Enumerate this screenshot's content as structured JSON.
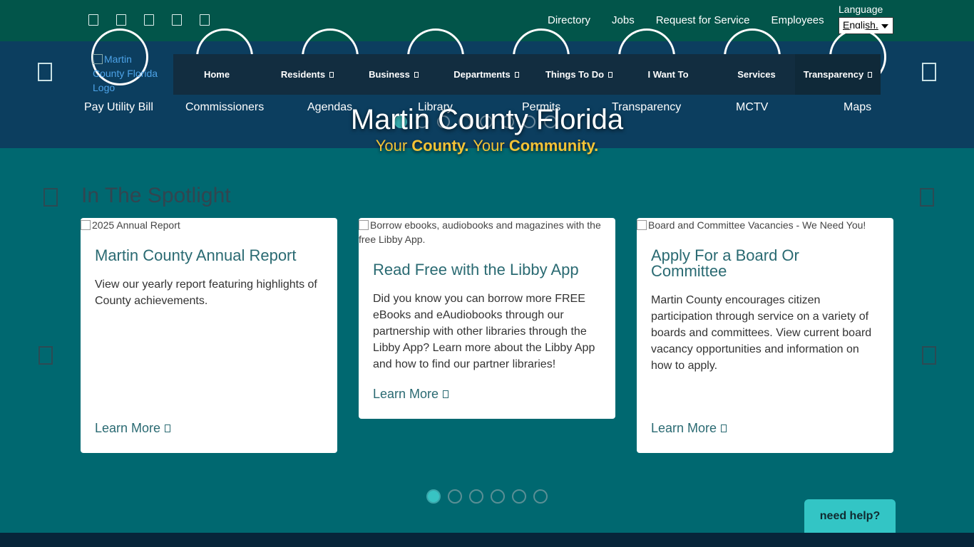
{
  "topbar": {
    "social_icons": [
      "social-icon-1",
      "social-icon-2",
      "social-icon-3",
      "social-icon-4",
      "social-icon-5"
    ],
    "links": [
      "Directory",
      "Jobs",
      "Request for Service",
      "Employees"
    ],
    "language_label": "Language",
    "language_value": "English."
  },
  "header": {
    "logo_alt": "Martin County Florida Logo",
    "nav": [
      {
        "label": "Home",
        "dropdown": false
      },
      {
        "label": "Residents",
        "dropdown": true
      },
      {
        "label": "Business",
        "dropdown": true
      },
      {
        "label": "Departments",
        "dropdown": true
      },
      {
        "label": "Things To Do",
        "dropdown": true
      },
      {
        "label": "I Want To",
        "dropdown": false
      },
      {
        "label": "Services",
        "dropdown": false
      },
      {
        "label": "Transparency",
        "dropdown": true
      }
    ],
    "quick_links": [
      "Pay Utility Bill",
      "Commissioners",
      "Agendas",
      "Library",
      "Permits",
      "Transparency",
      "MCTV",
      "Maps"
    ],
    "hero_title": "Martin County Florida",
    "hero_sub_1": "Your ",
    "hero_sub_2": "County.",
    "hero_sub_3": " Your ",
    "hero_sub_4": "Community."
  },
  "spotlight": {
    "title": "In The Spotlight",
    "cards": [
      {
        "img_alt": "2025 Annual Report",
        "title": "Martin County Annual Report",
        "body": "View our yearly report featuring highlights of County achievements.",
        "link": "Learn More"
      },
      {
        "img_alt": "Borrow ebooks, audiobooks and magazines with the free Libby App.",
        "title": "Read Free with the Libby App",
        "body": "Did you know you can borrow more FREE eBooks and eAudiobooks through our partnership with other libraries through the Libby App? Learn more about the Libby App and how to find our partner libraries!",
        "link": "Learn More"
      },
      {
        "img_alt": "Board and Committee Vacancies - We Need You!",
        "title": "Apply For a Board Or Committee",
        "body": "Martin County encourages citizen participation through service on a variety of boards and committees.  View current board vacancy opportunities and information on how to apply.",
        "link": "Learn More"
      }
    ]
  },
  "help_label": "need help?",
  "colors": {
    "accent": "#33c5c5",
    "topbar": "#02554a",
    "header": "#0c3e5f",
    "body": "#006870",
    "hero_sub": "#f4c235"
  }
}
